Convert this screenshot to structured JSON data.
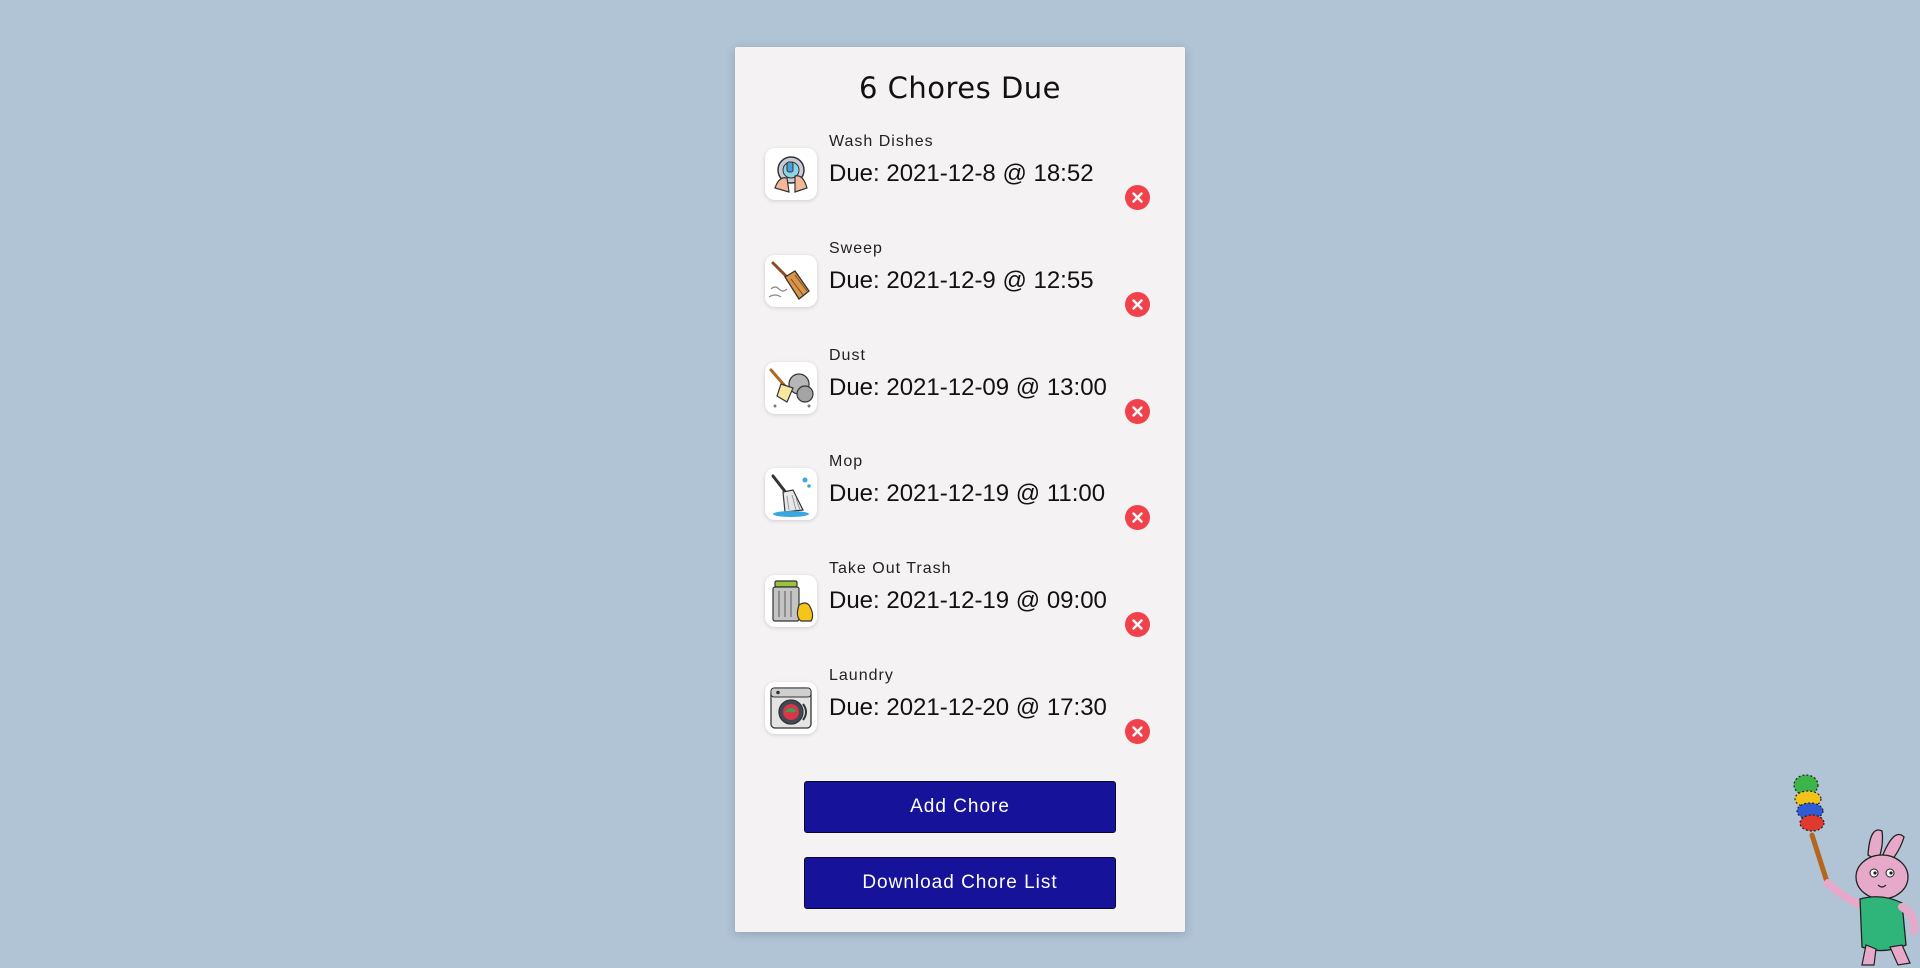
{
  "header": {
    "title": "6 Chores Due"
  },
  "chores": [
    {
      "name": "Wash Dishes",
      "due": "Due: 2021-12-8 @ 18:52",
      "icon": "wash-dishes-icon"
    },
    {
      "name": "Sweep",
      "due": "Due: 2021-12-9 @ 12:55",
      "icon": "broom-icon"
    },
    {
      "name": "Dust",
      "due": "Due: 2021-12-09 @ 13:00",
      "icon": "duster-icon"
    },
    {
      "name": "Mop",
      "due": "Due: 2021-12-19 @ 11:00",
      "icon": "mop-icon"
    },
    {
      "name": "Take Out Trash",
      "due": "Due: 2021-12-19 @ 09:00",
      "icon": "trash-can-icon"
    },
    {
      "name": "Laundry",
      "due": "Due: 2021-12-20 @ 17:30",
      "icon": "washing-machine-icon"
    }
  ],
  "actions": {
    "add_label": "Add Chore",
    "download_label": "Download Chore List"
  },
  "colors": {
    "background": "#b0c4d6",
    "card": "#f4f2f2",
    "button": "#16139a",
    "remove": "#f1414b"
  },
  "decor": {
    "mascot": "bunny-with-feather-duster"
  }
}
